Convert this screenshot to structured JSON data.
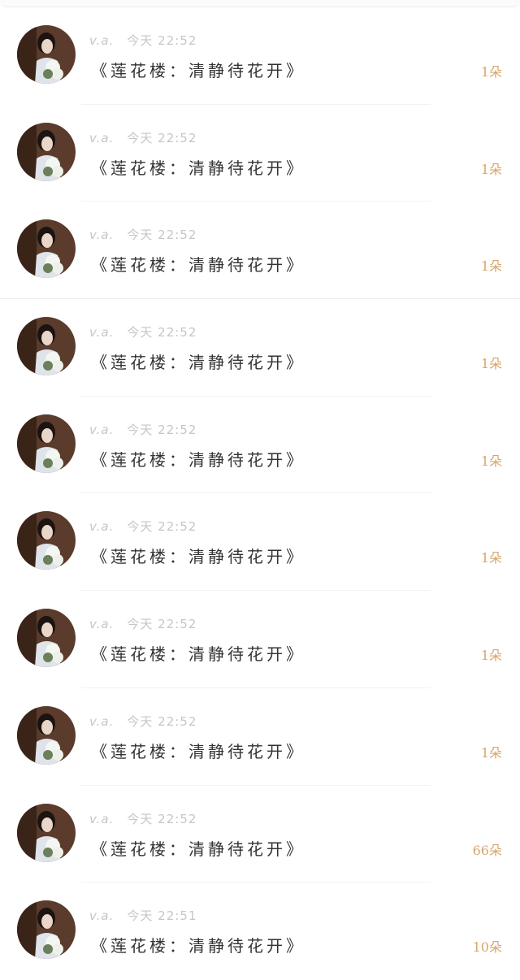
{
  "messages": [
    {
      "name": "v.a.",
      "time": "今天 22:52",
      "text": "《莲花楼：清静待花开》",
      "gift": "1朵"
    },
    {
      "name": "v.a.",
      "time": "今天 22:52",
      "text": "《莲花楼：清静待花开》",
      "gift": "1朵"
    },
    {
      "name": "v.a.",
      "time": "今天 22:52",
      "text": "《莲花楼：清静待花开》",
      "gift": "1朵"
    },
    {
      "name": "v.a.",
      "time": "今天 22:52",
      "text": "《莲花楼：清静待花开》",
      "gift": "1朵"
    },
    {
      "name": "v.a.",
      "time": "今天 22:52",
      "text": "《莲花楼：清静待花开》",
      "gift": "1朵"
    },
    {
      "name": "v.a.",
      "time": "今天 22:52",
      "text": "《莲花楼：清静待花开》",
      "gift": "1朵"
    },
    {
      "name": "v.a.",
      "time": "今天 22:52",
      "text": "《莲花楼：清静待花开》",
      "gift": "1朵"
    },
    {
      "name": "v.a.",
      "time": "今天 22:52",
      "text": "《莲花楼：清静待花开》",
      "gift": "1朵"
    },
    {
      "name": "v.a.",
      "time": "今天 22:52",
      "text": "《莲花楼：清静待花开》",
      "gift": "66朵"
    },
    {
      "name": "v.a.",
      "time": "今天 22:51",
      "text": "《莲花楼：清静待花开》",
      "gift": "10朵"
    }
  ],
  "colors": {
    "gift": "#d7a56c",
    "meta": "#c6c6c6",
    "text": "#333333"
  }
}
